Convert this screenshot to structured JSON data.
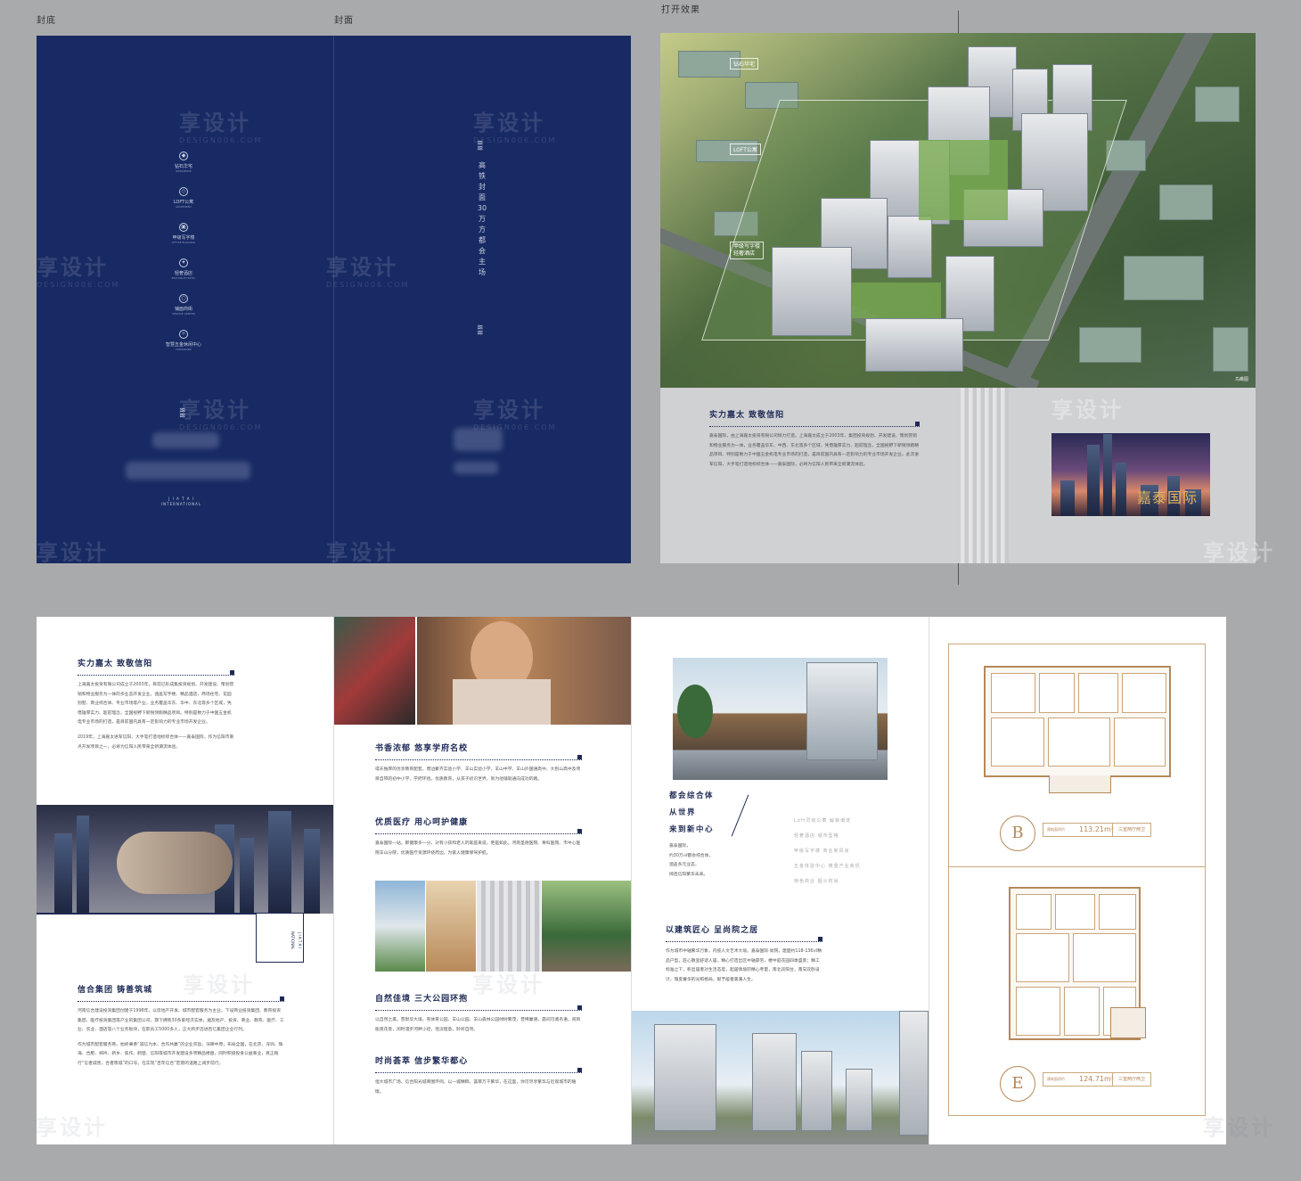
{
  "labels": {
    "back_cover": "封底",
    "front_cover": "封面",
    "open_effect": "打开效果"
  },
  "watermark": {
    "cn": "享设计",
    "en": "DESIGN006.COM"
  },
  "back_cover": {
    "icons": [
      {
        "icon": "diamond-icon",
        "label": "钻石华宅",
        "sub": "RESIDENCE"
      },
      {
        "icon": "loft-icon",
        "label": "LOFT公寓",
        "sub": "APARTMENT"
      },
      {
        "icon": "office-icon",
        "label": "甲级写字楼",
        "sub": "OFFICE BUILDING"
      },
      {
        "icon": "hotel-icon",
        "label": "轻奢酒店",
        "sub": "BOUTIQUE HOTEL"
      },
      {
        "icon": "shop-icon",
        "label": "铺面商街",
        "sub": "SERVICE CENTER"
      },
      {
        "icon": "trade-icon",
        "label": "智慧五金休闲中心",
        "sub": "HARDWARE"
      }
    ],
    "brand_en": "J I A T A I\nINTERNATIONAL"
  },
  "front_cover": {
    "vertical_text": "高铁封面30万方都会主场"
  },
  "aerial": {
    "tags": [
      "钻石华宅",
      "LOFT公寓",
      "甲级写字楼\n轻奢酒店"
    ],
    "note": "鸟瞰图"
  },
  "inner_right": {
    "heading": "实力嘉太  致敬信阳",
    "body": "嘉泰国际，由上海嘉太投资有限公司倾力打造。上海嘉太成立于2003年，集团投资规划、开发建设、策划营销和物业服务为一体，业务覆盖华东、中西、东北等多个区域，凭借雄厚实力、超前理念，全国视野下新锐领跑精品项目。特别是致力于中国五金机电专业市场的打造，是目前国内具有一定影响力的专业市场开发企业。此次进军信阳，大手笔打造地标综合体——嘉泰国际，必将为信阳人民带来全新潮流体验。",
    "city_name": "嘉泰国际"
  },
  "inside": {
    "p1_heading": "实力嘉太  致敬信阳",
    "p1_body": "上海嘉太投资有限公司成立于2003年，目前已形成集投资规划、开发建设、策划营销和物业服务为一体的多业态开发企业，涵盖写字楼、精品酒店、商场住宅、花园别墅、商业综合体、专业市场等产业，业务覆盖华东、华中、东北等多个区域，凭借雄厚实力、超前理念，全国视野下新锐领跑精品项目。特别是致力于中国五金机电专业市场的打造，是目前国内具有一定影响力的专业市场开发企业。",
    "p1_body2": "2019年，上海嘉太进军信阳，大手笔打造地标综合体——嘉泰国际，作为信阳市重点开发项目之一，必将为信阳人民带来全新潮流体验。",
    "p1_vert": "J I A T A I\nNATIONAL",
    "p1_heading2": "信合集团  铸善筑城",
    "p1_body3": "河南信合建设投资集团创建于1998年，以房地产开发、城市配套服务为主业，下设商业投资集团、教育投资集团、医疗投资集团等产业的集团公司，旗下拥有30多家经济实体，遍及地产、投资、商业、教育、医疗、工业、农业、酒店等八个业务板块，在职员工5000多人，正大跨步迈进百亿集团企业行列。",
    "p1_body4": "作为城市配套服务商，始终秉承“诚信为本，合作共赢”的企业宗旨，深耕中原，布局全国，在北京、深圳、珠海、合肥、郑州、新乡、焦作、鹤壁、信阳等城市开发建设多项精品楼盘，同时积极投身公益事业，真正践行“信者诚善，合者筑城”的口号，在实现“百年信合”宏愿的道路上阔步前行。",
    "p2_h1": "书香浓郁  悠享学府名校",
    "p2_b1": "得天独厚的优享教育配套，周边聚齐实验小学、羊山实验小学、羊山中学、羊山外国语高中、大别山高中及项目自带的初中小学，学府环绕，优质教育，从孩子初识世界，到为他铺就通向成功的路。",
    "p2_h2": "优质医疗  用心呵护健康",
    "p2_b2": "嘉泰国际一站，即健康多一分，对有小孩和老人的家庭来说，更是如此。河南圣德医院、骨科医院、市中心医院羊山分院，优质医疗资源环绕周边，为家人健康保驾护航。",
    "p2_h3": "自然佳境  三大公园环抱",
    "p2_b3": "以自然之美，营默华大境，有体育公园、羊山公园、羊山森林公园绿树繁茂，普稀赢语，晨间可闻鸟语，闲目能观花景，闲时漫步河畔小径，恬淡惬意，聆听自然。",
    "p2_h4": "时尚荟萃  信步繁华都心",
    "p2_b4": "恒大城市广场、信合阳光城商圈环伺，以一城精粹，荟萃万千繁华，在这里，你可尽享繁华与近观城市的璀璨。",
    "p3_lines": [
      "都会综合体",
      "从世界",
      "来到新中心"
    ],
    "p3_phrases": [
      "Loft灵动公寓  解锁潮流",
      "轻奢酒店  城市型格",
      "甲级写字楼  商业新风尚",
      "五金体验中心  铸重产业商机",
      "特色商业  烟火时尚"
    ],
    "p3_body": "嘉泰国际，\n约30万㎡都会综合体，\n涵盖多元业态，\n缔造信阳繁华未来。",
    "p3_heading": "以建筑匠心  呈尚院之居",
    "p3_body2": "作为城市中轴繁华万象，内揽人文艺术大境。嘉泰国际·尚院，建面约118-136㎡精品户型，匠心敬呈舒适人居，精心打造出区中轴豪宅，楼中庭花园四季盛景；精工标准之下，彰显居者对生活态度，起居情境的精心考量，南北双阳台，南向双卧设计，瑰变奢华的光照格局，赋予居者美满人生。",
    "plan_b": {
      "letter": "B",
      "area": "113.21m²",
      "type": "三室两厅两卫",
      "small": "建筑面积约"
    },
    "plan_e": {
      "letter": "E",
      "area": "124.71m²",
      "type": "三室两厅两卫",
      "small": "建筑面积约"
    }
  }
}
